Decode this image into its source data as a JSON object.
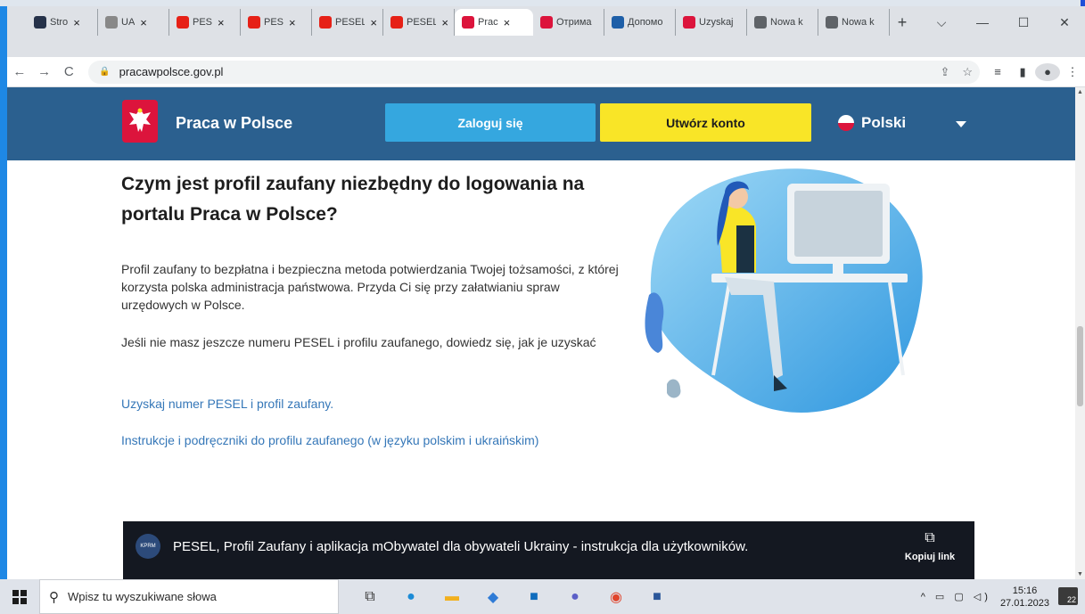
{
  "browser": {
    "tabs": [
      {
        "title": "Stro",
        "color": "#26324a",
        "active": false
      },
      {
        "title": "UA",
        "color": "#888888",
        "active": false
      },
      {
        "title": "PES",
        "color": "#e62117",
        "active": false
      },
      {
        "title": "PES",
        "color": "#e62117",
        "active": false
      },
      {
        "title": "PESEL, F",
        "color": "#e62117",
        "active": false
      },
      {
        "title": "PESEL, F",
        "color": "#e62117",
        "active": false
      },
      {
        "title": "Prac",
        "color": "#dc143c",
        "active": true
      },
      {
        "title": "Отрима",
        "color": "#dc143c",
        "active": false
      },
      {
        "title": "Допомо",
        "color": "#1e5fa8",
        "active": false
      },
      {
        "title": "Uzyskaj",
        "color": "#dc143c",
        "active": false
      },
      {
        "title": "Nowa k",
        "color": "#5f6368",
        "active": false
      },
      {
        "title": "Nowa k",
        "color": "#5f6368",
        "active": false
      }
    ],
    "close_glyph": "×",
    "new_tab_glyph": "+",
    "window_controls": {
      "tablist": "⌵",
      "minimize": "—",
      "maximize": "☐",
      "close": "✕"
    },
    "url": "pracawpolsce.gov.pl",
    "nav": {
      "back": "←",
      "forward": "→",
      "reload": "C"
    },
    "toolbar_icons": {
      "share": "⇪",
      "star": "☆",
      "media": "≡",
      "sidepanel": "▮",
      "menu": "⋮"
    }
  },
  "site": {
    "name": "Praca w Polsce",
    "login_label": "Zaloguj się",
    "create_label": "Utwórz konto",
    "language": "Polski"
  },
  "content": {
    "heading": "Czym jest profil zaufany niezbędny do logowania na portalu Praca w Polsce?",
    "paragraph1": "Profil zaufany to bezpłatna i bezpieczna metoda potwierdzania Twojej tożsamości, z której korzysta polska administracja państwowa. Przyda Ci się przy załatwianiu spraw urzędowych w Polsce.",
    "paragraph2": "Jeśli nie masz jeszcze numeru PESEL i profilu zaufanego, dowiedz się, jak je uzyskać",
    "link1": "Uzyskaj numer PESEL i profil zaufany.",
    "link2": "Instrukcje i podręczniki do profilu zaufanego (w języku polskim i ukraińskim)"
  },
  "video": {
    "channel_badge": "KPRM",
    "title": "PESEL, Profil Zaufany i aplikacja mObywatel dla obywateli Ukrainy - instrukcja dla użytkowników.",
    "copy_label": "Kopiuj link"
  },
  "taskbar": {
    "search_placeholder": "Wpisz tu wyszukiwane słowa",
    "time": "15:16",
    "date": "27.01.2023",
    "notifications": "22"
  },
  "colors": {
    "header_bg": "#2b608f",
    "login_bg": "#35a7df",
    "create_bg": "#f9e527",
    "link": "#3577b8",
    "accent_strip": "#1e88e5"
  }
}
